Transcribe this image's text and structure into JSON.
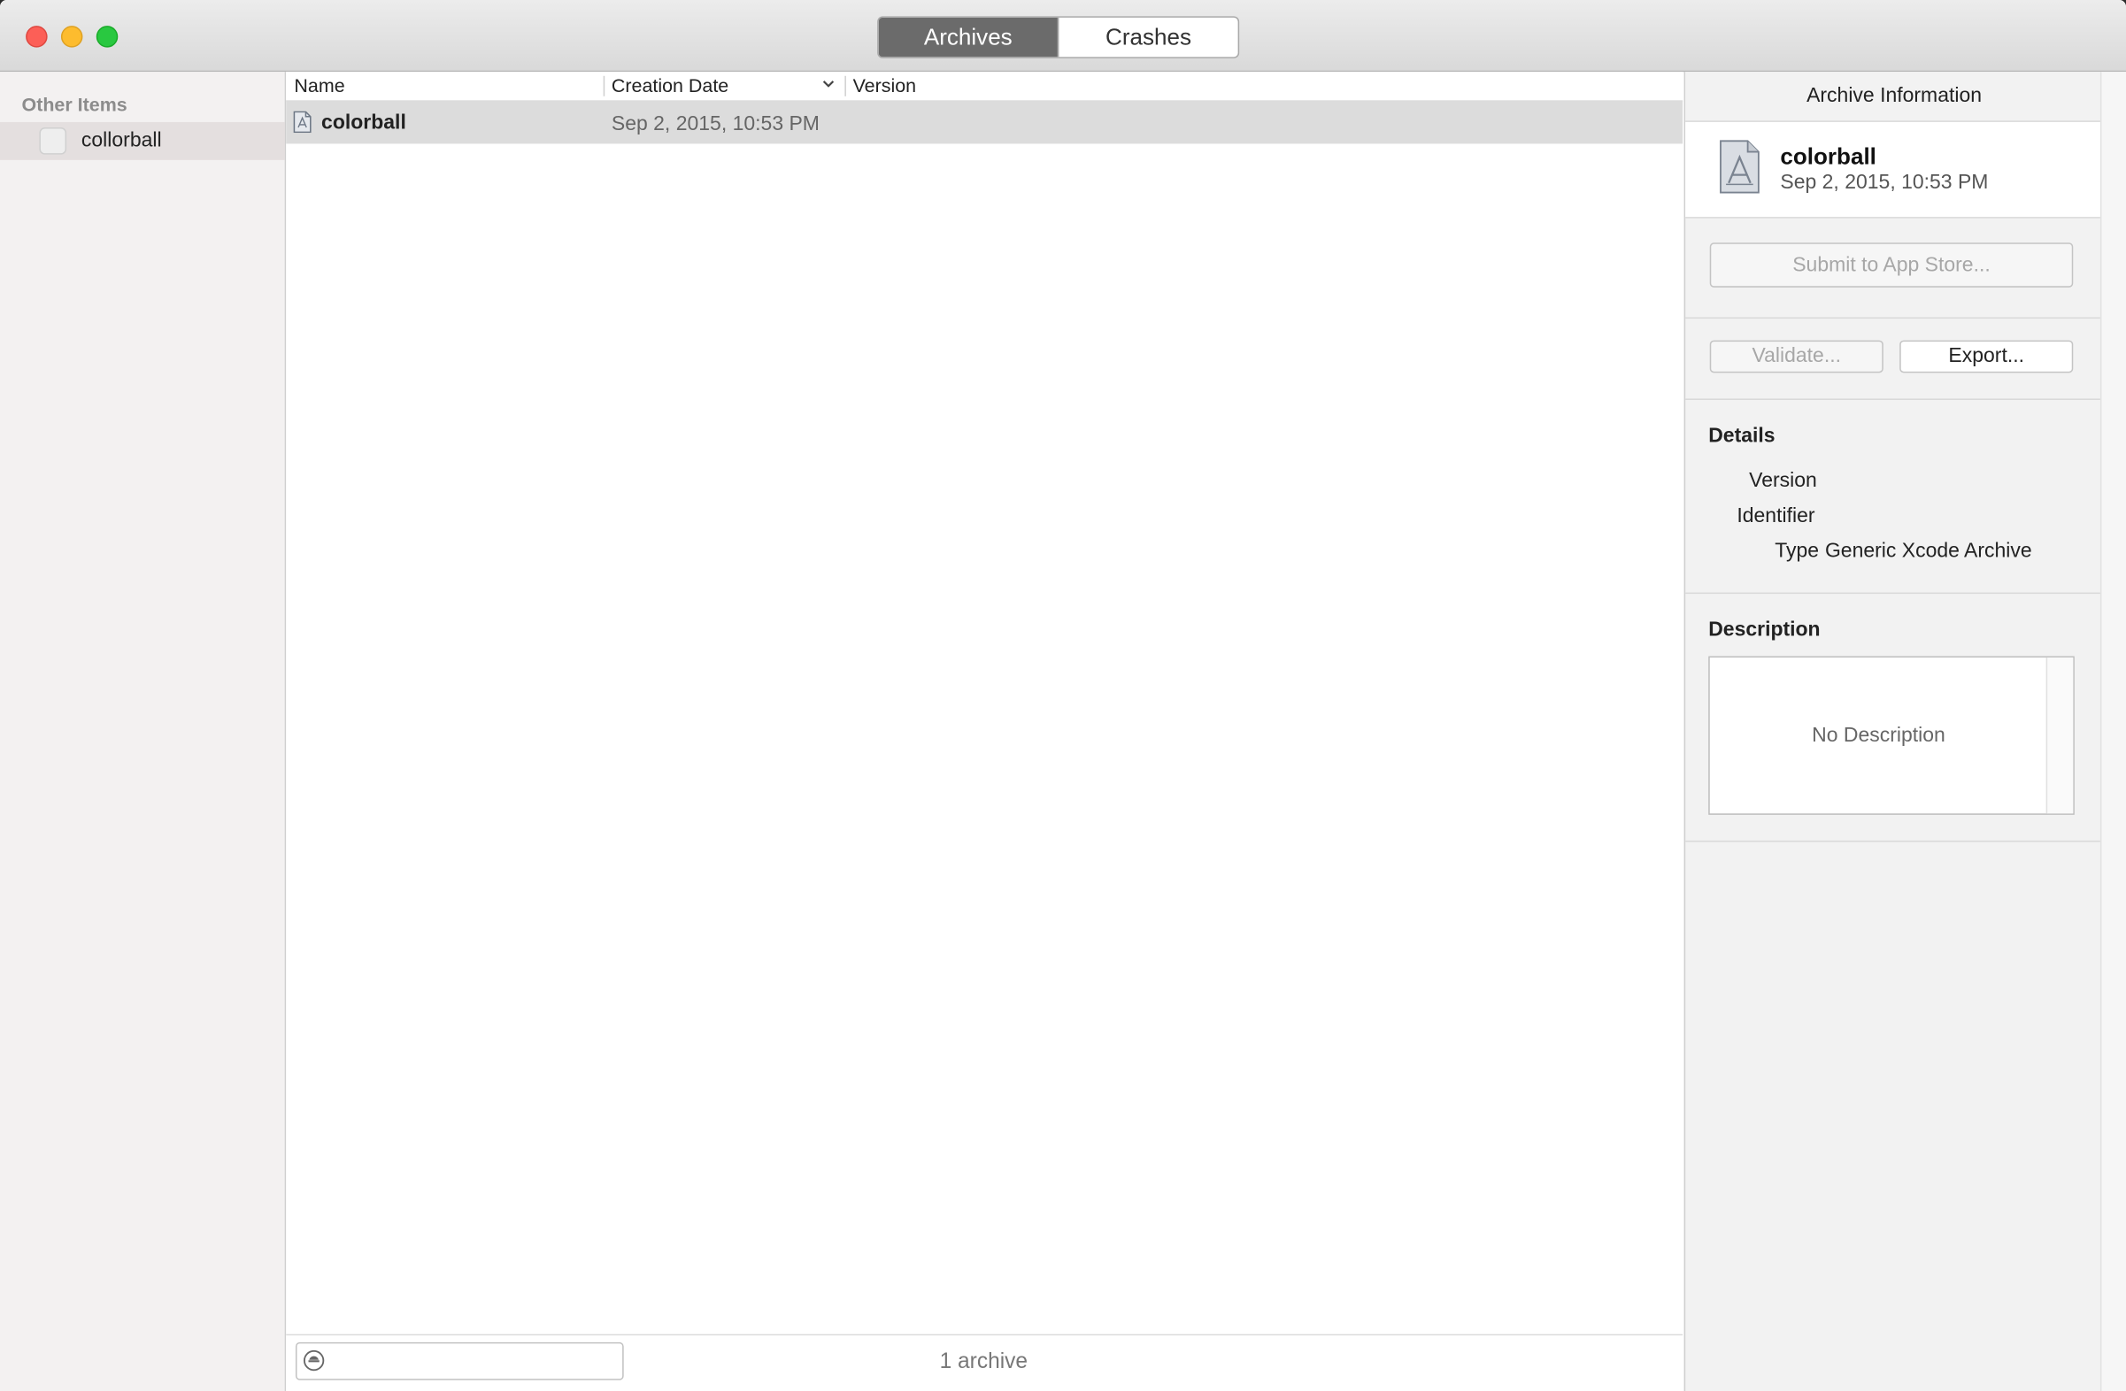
{
  "titlebar": {
    "tabs": [
      {
        "label": "Archives",
        "active": true
      },
      {
        "label": "Crashes",
        "active": false
      }
    ]
  },
  "sidebar": {
    "heading": "Other Items",
    "items": [
      {
        "label": "collorball",
        "selected": true
      }
    ]
  },
  "table": {
    "columns": {
      "name": "Name",
      "creation_date": "Creation Date",
      "version": "Version"
    },
    "sort_column": "Creation Date",
    "sort_direction": "descending",
    "rows": [
      {
        "name": "colorball",
        "creation_date": "Sep 2, 2015, 10:53 PM",
        "version": ""
      }
    ],
    "footer_count": "1 archive"
  },
  "inspector": {
    "title": "Archive Information",
    "archive_name": "colorball",
    "archive_date": "Sep 2, 2015, 10:53 PM",
    "submit_label": "Submit to App Store...",
    "validate_label": "Validate...",
    "export_label": "Export...",
    "details_title": "Details",
    "details": {
      "version_key": "Version",
      "version_val": "",
      "identifier_key": "Identifier",
      "identifier_val": "",
      "type_key": "Type",
      "type_val": "Generic Xcode Archive"
    },
    "description_title": "Description",
    "description_placeholder": "No Description"
  },
  "colors": {
    "selected_row": "#dcdcdc",
    "active_tab": "#6b6b6b",
    "close": "#fc5f57",
    "minimize": "#fdbc2e",
    "zoom": "#29c840"
  }
}
